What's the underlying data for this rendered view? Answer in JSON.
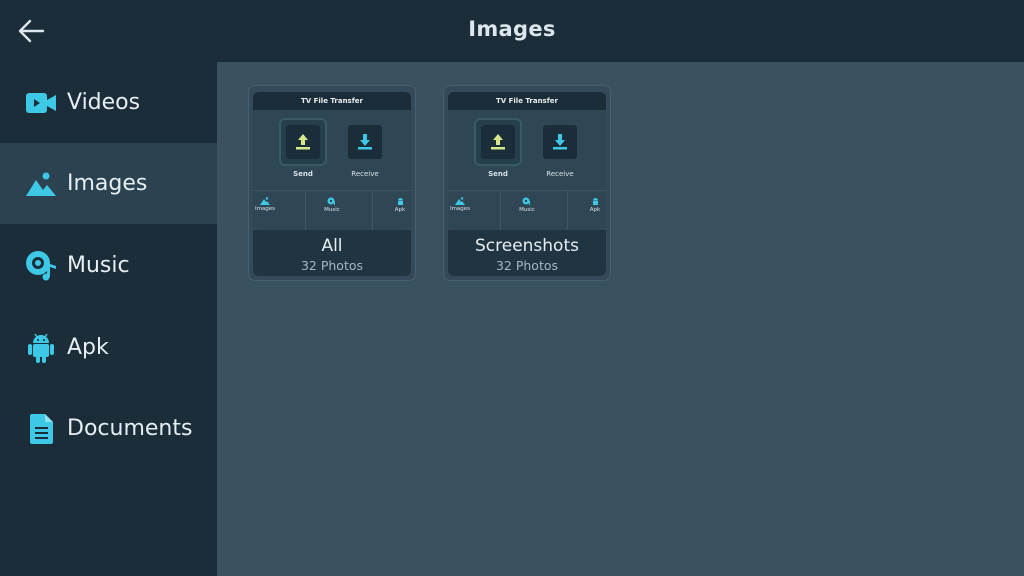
{
  "header": {
    "title": "Images"
  },
  "sidebar": {
    "items": [
      {
        "label": "Videos",
        "icon": "video-icon"
      },
      {
        "label": "Images",
        "icon": "image-icon",
        "active": true
      },
      {
        "label": "Music",
        "icon": "music-icon"
      },
      {
        "label": "Apk",
        "icon": "android-icon"
      },
      {
        "label": "Documents",
        "icon": "document-icon"
      }
    ]
  },
  "folders": [
    {
      "name": "All",
      "count": "32 Photos",
      "thumb": {
        "header": "TV File Transfer",
        "send": "Send",
        "receive": "Receive",
        "tabs": [
          "Images",
          "Music",
          "Apk"
        ]
      }
    },
    {
      "name": "Screenshots",
      "count": "32 Photos",
      "thumb": {
        "header": "TV File Transfer",
        "send": "Send",
        "receive": "Receive",
        "tabs": [
          "Images",
          "Music",
          "Apk"
        ]
      }
    }
  ],
  "colors": {
    "accent": "#3dc8e6",
    "send_accent": "#d6e88a",
    "background": "#3a5160",
    "sidebar": "#1b2d39"
  }
}
